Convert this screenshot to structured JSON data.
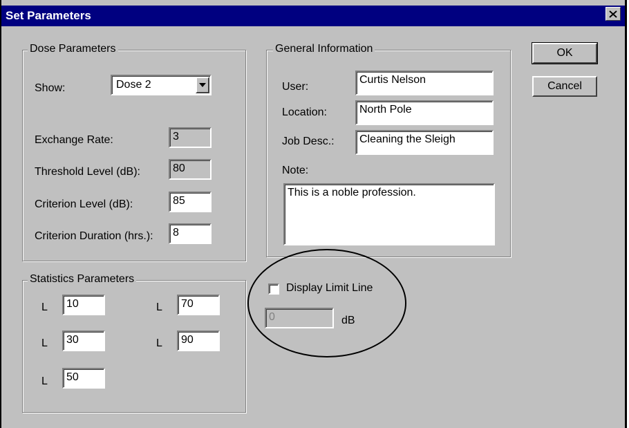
{
  "window": {
    "title": "Set Parameters"
  },
  "buttons": {
    "ok": "OK",
    "cancel": "Cancel"
  },
  "dose": {
    "legend": "Dose Parameters",
    "show_label": "Show:",
    "show_value": "Dose 2",
    "exchange_rate_label": "Exchange Rate:",
    "exchange_rate_value": "3",
    "threshold_label": "Threshold Level (dB):",
    "threshold_value": "80",
    "criterion_level_label": "Criterion Level (dB):",
    "criterion_level_value": "85",
    "criterion_duration_label": "Criterion Duration (hrs.):",
    "criterion_duration_value": "8"
  },
  "stats": {
    "legend": "Statistics Parameters",
    "l_label": "L",
    "values": [
      "10",
      "30",
      "50",
      "70",
      "90"
    ]
  },
  "general": {
    "legend": "General Information",
    "user_label": "User:",
    "user_value": "Curtis Nelson",
    "location_label": "Location:",
    "location_value": "North Pole",
    "job_label": "Job Desc.:",
    "job_value": "Cleaning the Sleigh",
    "note_label": "Note:",
    "note_value": "This is a noble profession."
  },
  "limit": {
    "checkbox_label": "Display Limit Line",
    "checked": false,
    "value": "0",
    "unit": "dB"
  },
  "icons": {
    "close": "close-icon",
    "dropdown": "chevron-down-icon"
  }
}
